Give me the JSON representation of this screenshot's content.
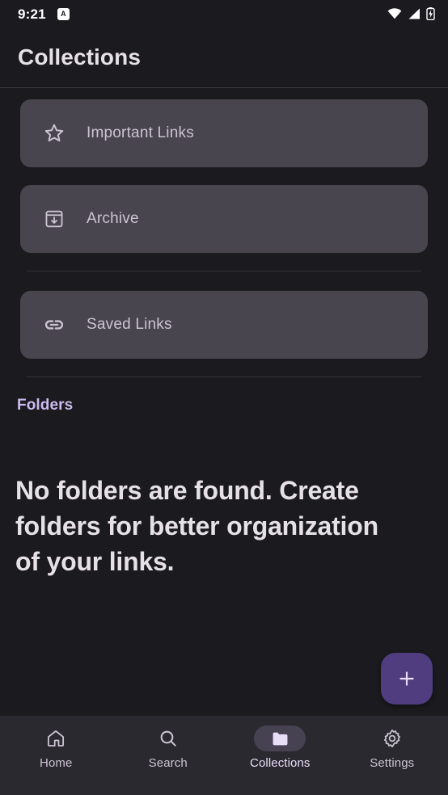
{
  "status_bar": {
    "time": "9:21",
    "app_badge_letter": "A",
    "icons": [
      "wifi-icon",
      "cellular-signal-icon",
      "battery-charging-icon"
    ]
  },
  "header": {
    "title": "Collections"
  },
  "collections": [
    {
      "label": "Important Links",
      "icon": "star-icon"
    },
    {
      "label": "Archive",
      "icon": "archive-box-icon"
    },
    {
      "label": "Saved Links",
      "icon": "link-chain-icon"
    }
  ],
  "folders_section": {
    "title": "Folders",
    "empty_message": "No folders are found. Create folders for better organization of your links."
  },
  "fab": {
    "icon": "plus-icon",
    "label": "+"
  },
  "bottom_nav": {
    "items": [
      {
        "label": "Home",
        "icon": "home-icon",
        "active": false
      },
      {
        "label": "Search",
        "icon": "search-icon",
        "active": false
      },
      {
        "label": "Collections",
        "icon": "folder-icon",
        "active": true
      },
      {
        "label": "Settings",
        "icon": "gear-icon",
        "active": false
      }
    ]
  },
  "colors": {
    "background": "#1b1b1f",
    "card": "#49454f",
    "accent_purple": "#cbbbee",
    "fab": "#4f3d80",
    "nav_background": "#2b2930",
    "nav_active_pill": "#474252",
    "text_primary": "#e6e1e5",
    "text_secondary": "#cac4d0"
  }
}
